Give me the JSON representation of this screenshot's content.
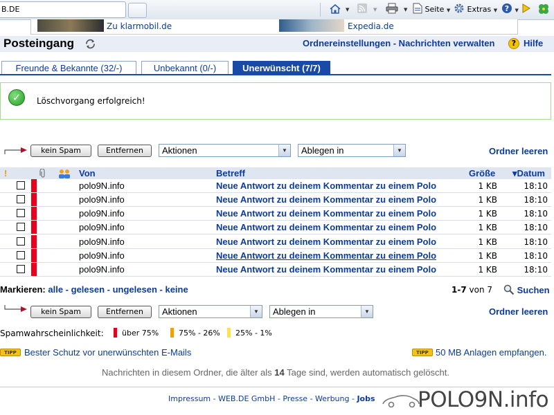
{
  "browser": {
    "tab_title": "B.DE",
    "toolbar": {
      "seite_label": "Seite",
      "extras_label": "Extras"
    }
  },
  "ads": [
    {
      "label": "Zu klarmobil.de"
    },
    {
      "label": "Expedia.de"
    }
  ],
  "header": {
    "title": "Posteingang",
    "links": "Ordnereinstellungen - Nachrichten verwalten",
    "help_label": "Hilfe"
  },
  "tabs": [
    {
      "label": "Freunde & Bekannte (32/-)",
      "active": false
    },
    {
      "label": "Unbekannt (0/-)",
      "active": false
    },
    {
      "label": "Unerwünscht (7/7)",
      "active": true
    }
  ],
  "status": {
    "message": "Löschvorgang erfolgreich!"
  },
  "actions": {
    "not_spam": "kein Spam",
    "remove": "Entfernen",
    "actions_select": "Aktionen",
    "file_select": "Ablegen in",
    "empty_folder": "Ordner leeren"
  },
  "table": {
    "columns": {
      "from": "Von",
      "subject": "Betreff",
      "size": "Größe",
      "date": "▾Datum"
    },
    "rows": [
      {
        "from": "polo9N.info",
        "subject": "Neue Antwort zu deinem Kommentar zu einem Polo",
        "size": "1 KB",
        "date": "18:10"
      },
      {
        "from": "polo9N.info",
        "subject": "Neue Antwort zu deinem Kommentar zu einem Polo",
        "size": "1 KB",
        "date": "18:10"
      },
      {
        "from": "polo9N.info",
        "subject": "Neue Antwort zu deinem Kommentar zu einem Polo",
        "size": "1 KB",
        "date": "18:10"
      },
      {
        "from": "polo9N.info",
        "subject": "Neue Antwort zu deinem Kommentar zu einem Polo",
        "size": "1 KB",
        "date": "18:10"
      },
      {
        "from": "polo9N.info",
        "subject": "Neue Antwort zu deinem Kommentar zu einem Polo",
        "size": "1 KB",
        "date": "18:10"
      },
      {
        "from": "polo9N.info",
        "subject": "Neue Antwort zu deinem Kommentar zu einem Polo",
        "size": "1 KB",
        "date": "18:10"
      },
      {
        "from": "polo9N.info",
        "subject": "Neue Antwort zu deinem Kommentar zu einem Polo",
        "size": "1 KB",
        "date": "18:10"
      }
    ]
  },
  "marking": {
    "label": "Markieren:",
    "all": "alle",
    "read": "gelesen",
    "unread": "ungelesen",
    "none": "keine",
    "sep": " - "
  },
  "pager": {
    "range": "1-7",
    "of_label": "von",
    "total": "7"
  },
  "search_label": "Suchen",
  "spam_legend": {
    "label": "Spamwahrscheinlichkeit:",
    "high": "über 75%",
    "mid": "75% - 26%",
    "low": "25% - 1%",
    "colors": {
      "high": "#e8001c",
      "mid": "#f5a000",
      "low": "#ffe24a"
    }
  },
  "tips": {
    "badge": "TIPP",
    "left": "Bester Schutz vor unerwünschten E-Mails",
    "right": "50 MB Anlagen empfangen."
  },
  "notice": {
    "before": "Nachrichten in diesem Ordner, die älter als ",
    "days": "14",
    "after": " Tage sind, werden automatisch gelöscht."
  },
  "footer": {
    "impressum": "Impressum",
    "company": "WEB.DE GmbH",
    "presse": "Presse",
    "werbung": "Werbung",
    "jobs": "Jobs",
    "sep": " - "
  },
  "watermark": "POLO9N.info"
}
